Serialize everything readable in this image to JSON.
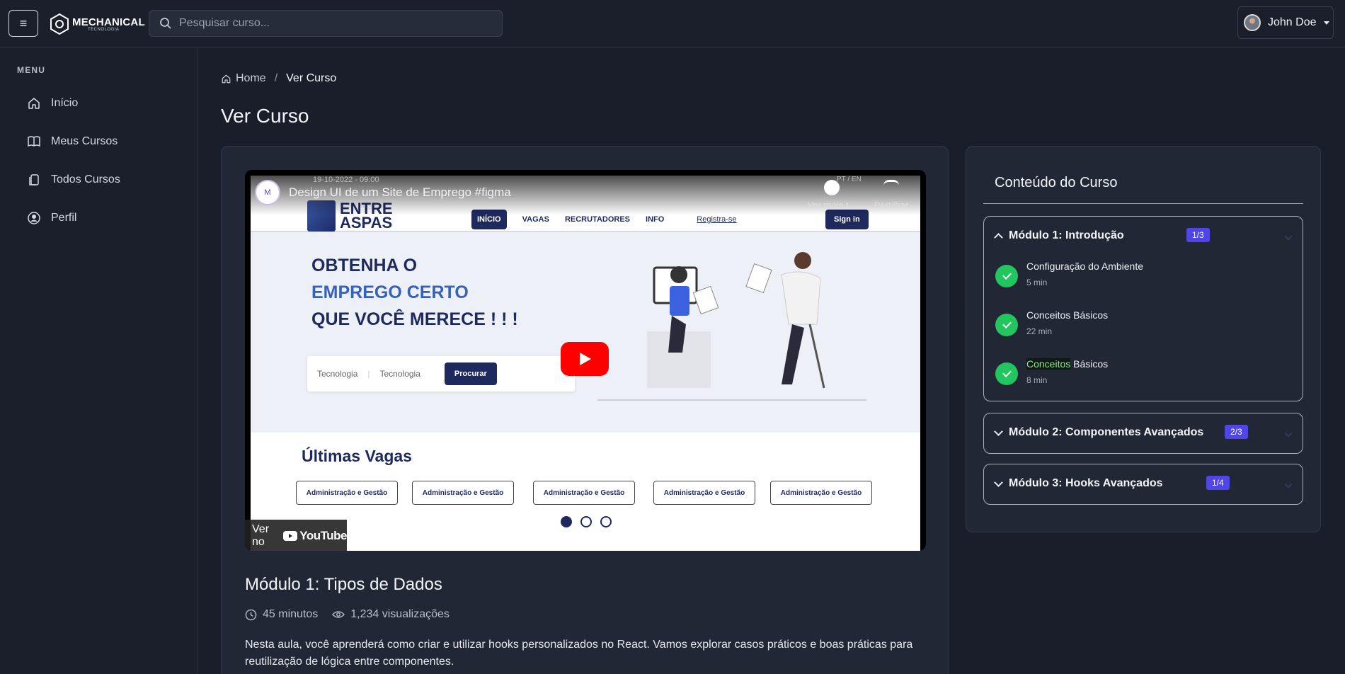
{
  "header": {
    "menu_glyph": "≡",
    "logo_title": "MECHANICAL",
    "logo_sub": "TECNOLOGIA",
    "search_placeholder": "Pesquisar curso...",
    "user_name": "John Doe"
  },
  "sidebar": {
    "title": "MENU",
    "items": [
      {
        "label": "Início",
        "icon": "home-icon"
      },
      {
        "label": "Meus Cursos",
        "icon": "book-icon"
      },
      {
        "label": "Todos Cursos",
        "icon": "copy-icon"
      },
      {
        "label": "Perfil",
        "icon": "user-circle-icon"
      }
    ]
  },
  "breadcrumb": {
    "home": "Home",
    "separator": "/",
    "current": "Ver Curso"
  },
  "page_title": "Ver Curso",
  "video": {
    "yt_title": "Design UI de um Site de Emprego #figma",
    "yt_date": "19-10-2022  -  09:00",
    "yt_lang": "PT / EN",
    "yt_channel": "M",
    "yt_watch_later": "Ver mais t...",
    "yt_share": "Partilhar",
    "site_logo": "ENTRE ASPAS",
    "site_links": [
      "INÍCIO",
      "VAGAS",
      "RECRUTADORES",
      "INFO"
    ],
    "site_register": "Registra-se",
    "site_signin": "Sign in",
    "hero_line1": "OBTENHA O",
    "hero_line2": "EMPREGO CERTO",
    "hero_line3": "QUE VOCÊ MERECE ! ! !",
    "hero_select1": "Tecnologia",
    "hero_select2": "Tecnologia",
    "hero_button": "Procurar",
    "jobs_title": "Últimas Vagas",
    "job_tags": [
      "Administração e Gestão",
      "Administração e Gestão",
      "Administração e Gestão",
      "Administração e Gestão",
      "Administração e Gestão"
    ],
    "watch_on": "Ver no",
    "youtube": "YouTube"
  },
  "lesson": {
    "title": "Módulo 1: Tipos de Dados",
    "duration": "45 minutos",
    "views": "1,234 visualizações",
    "description": "Nesta aula, você aprenderá como criar e utilizar hooks personalizados no React. Vamos explorar casos práticos e boas práticas para reutilização de lógica entre componentes."
  },
  "course_content": {
    "title": "Conteúdo do Curso",
    "accent": "#4f46e5",
    "success": "#22c55e",
    "modules": [
      {
        "title": "Módulo 1: Introdução",
        "badge": "1/3",
        "expanded": true,
        "lessons": [
          {
            "title": "Configuração do Ambiente",
            "duration": "5 min"
          },
          {
            "title": "Conceitos Básicos",
            "duration": "22 min"
          },
          {
            "title_hl": "Conceitos",
            "title_rest": " Básicos",
            "duration": "8 min"
          }
        ]
      },
      {
        "title": "Módulo 2: Componentes Avançados",
        "badge": "2/3",
        "expanded": false
      },
      {
        "title": "Módulo 3: Hooks Avançados",
        "badge": "1/4",
        "expanded": false
      }
    ]
  }
}
